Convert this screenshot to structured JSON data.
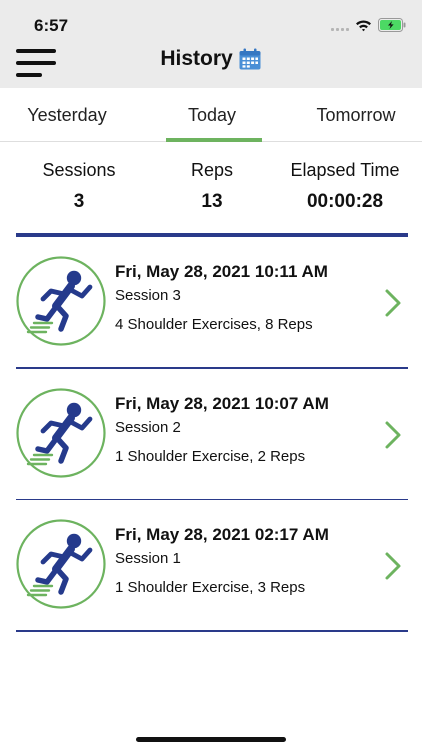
{
  "status_bar": {
    "time": "6:57"
  },
  "header": {
    "title": "History"
  },
  "tabs": [
    {
      "label": "Yesterday"
    },
    {
      "label": "Today"
    },
    {
      "label": "Tomorrow"
    }
  ],
  "selected_tab": "Today",
  "summary": {
    "sessions_label": "Sessions",
    "sessions_value": "3",
    "reps_label": "Reps",
    "reps_value": "13",
    "elapsed_label": "Elapsed Time",
    "elapsed_value": "00:00:28"
  },
  "history": [
    {
      "date": "Fri, May 28, 2021 10:11 AM",
      "session": "Session 3",
      "summary": "4 Shoulder Exercises, 8 Reps"
    },
    {
      "date": "Fri, May 28, 2021 10:07 AM",
      "session": "Session 2",
      "summary": "1 Shoulder Exercise, 2 Reps"
    },
    {
      "date": "Fri, May 28, 2021 02:17 AM",
      "session": "Session 1",
      "summary": "1 Shoulder Exercise, 3 Reps"
    }
  ],
  "icons": {
    "menu": "hamburger-menu-icon",
    "title": "calendar-icon",
    "session": "runner-icon",
    "row_action": "chevron-right-icon"
  },
  "colors": {
    "accent_green": "#6db35f",
    "navy": "#2a3a8a",
    "calendar_blue": "#4a8fd6",
    "runner_navy": "#253a8c",
    "battery_green": "#4cd964"
  }
}
